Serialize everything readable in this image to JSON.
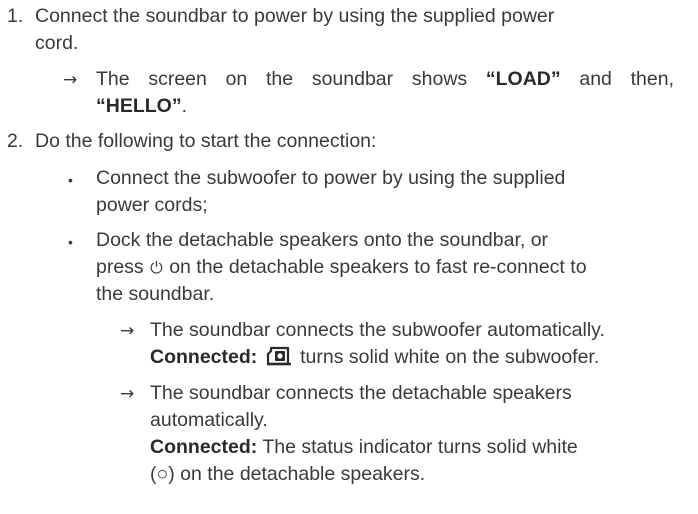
{
  "steps": [
    {
      "number": "1.",
      "lines": [
        "Connect the soundbar to power by using the supplied power",
        "cord."
      ],
      "result": {
        "pre": "The screen on the soundbar shows ",
        "bold1": "“LOAD”",
        "mid": " and then,",
        "bold2": "“HELLO”",
        "post": "."
      }
    },
    {
      "number": "2.",
      "intro": "Do the following to start the connection:",
      "bullets": [
        {
          "lines": [
            "Connect the subwoofer to power by using the supplied",
            "power cords;"
          ]
        },
        {
          "line1": "Dock the detachable speakers onto the soundbar, or",
          "line2_pre": "press",
          "line2_post": "on the detachable speakers to fast re-connect to",
          "line3": "the soundbar."
        }
      ],
      "results": [
        {
          "line1": "The soundbar connects the subwoofer automatically.",
          "label": "Connected:",
          "line2_post": "turns solid white on the subwoofer."
        },
        {
          "line1": "The soundbar connects the detachable speakers",
          "line2": "automatically.",
          "label": "Connected:",
          "line3_post": " The status indicator turns solid white",
          "line4": "(○) on the detachable speakers."
        }
      ]
    }
  ],
  "icons": {
    "arrow": "→",
    "bullet": "•",
    "power": "⏻"
  }
}
